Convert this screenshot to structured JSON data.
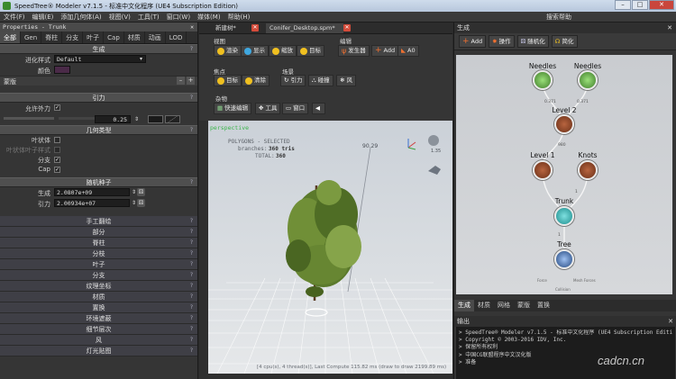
{
  "window": {
    "title": "SpeedTree® Modeler v7.1.5 - 标准中文化程序 (UE4 Subscription Edition)",
    "controls": [
      "–",
      "□",
      "✕"
    ]
  },
  "menu": {
    "items": [
      "文件(F)",
      "编辑(E)",
      "添加几何体(A)",
      "视图(V)",
      "工具(T)",
      "窗口(W)",
      "媒体(M)",
      "帮助(H)"
    ],
    "search_help": "搜索帮助"
  },
  "properties": {
    "panel_title": "Properties - Trunk",
    "tabs": [
      "全部",
      "Gen",
      "脊柱",
      "分支",
      "叶子",
      "Cap",
      "材质",
      "动画",
      "LOD"
    ],
    "sections": {
      "generation": "生成",
      "generation_style_label": "进化样式",
      "generation_style_value": "Default",
      "generation_color_label": "颜色",
      "mask": "蒙版",
      "mask_buttons": [
        "–",
        "+"
      ],
      "gravity": "引力",
      "gravity_allow_label": "允许外力",
      "gravity_value": "0.25",
      "geometry_type": "几何类型",
      "leaf_shape_label": "叶状体",
      "leaf_shape_sub_label": "叶状体叶子样式",
      "branches_label": "分支",
      "cap_label": "Cap",
      "random_seed": "随机种子",
      "seed_generation_label": "生成",
      "seed_generation_value": "2.0807e+09",
      "seed_gravity_label": "引力",
      "seed_gravity_value": "2.00934e+07"
    },
    "collapsed_sections": [
      "手工翻绘",
      "部分",
      "脊柱",
      "分枝",
      "叶子",
      "分支",
      "纹理坐标",
      "材质",
      "置换",
      "环境遮蔽",
      "细节层次",
      "风",
      "灯光贴图"
    ]
  },
  "documents": {
    "tabs": [
      "新建树*",
      "Conifer_Desktop.spm*"
    ]
  },
  "toolbar": {
    "view_group": "视图",
    "view_buttons": [
      "渲染",
      "显示",
      "缩放",
      "目标"
    ],
    "edit_group": "编辑",
    "edit_buttons": [
      "发生器",
      "Add",
      "A0"
    ],
    "focus_group": "焦点",
    "focus_buttons": [
      "目标",
      "清除"
    ],
    "scene_group": "场景",
    "scene_buttons": [
      "引力",
      "碰撞",
      "风"
    ],
    "misc_group": "杂物",
    "misc_buttons": [
      "快速编辑",
      "工具",
      "窗口"
    ]
  },
  "viewport": {
    "label": "perspective",
    "stats_title": "POLYGONS - SELECTED",
    "branches_label": "branches:",
    "branches_value": "360 tris",
    "total_label": "TOTAL:",
    "total_value": "360",
    "height_label": "90.29",
    "zoom_label": "1.35",
    "status": "[4 cpu(s), 4 thread(s)], Last Compute 115.82 ms (draw to draw 2199.89 ms)"
  },
  "generators": {
    "panel_title": "生成",
    "buttons": [
      "Add",
      "操作",
      "随机化",
      "简化"
    ],
    "nodes": {
      "needles_1": "Needles",
      "needles_2": "Needles",
      "level2": "Level 2",
      "level1": "Level 1",
      "knots": "Knots",
      "trunk": "Trunk",
      "tree": "Tree"
    },
    "edge_labels": {
      "n1": "0.371",
      "n2": "0.371",
      "l2": "980",
      "k": "1",
      "t": "1"
    },
    "footer_labels": [
      "Force",
      "Mesh Forces",
      "Collision"
    ]
  },
  "bottom_tabs": [
    "生成",
    "材质",
    "网格",
    "蒙版",
    "置换"
  ],
  "output": {
    "title": "输出",
    "lines": [
      "> SpeedTree® Modeler v7.1.5 - 标准中文化程序 (UE4 Subscription Edition)",
      "> Copyright © 2003-2016 IDV, Inc.",
      "> 保留所有权利",
      "> 中国CG联盟程序中文汉化版",
      "> 准备"
    ]
  },
  "watermark": "cadcn.cn",
  "colors": {
    "accent_red": "#d34b3a",
    "node_green": "#4f8d37",
    "node_brown": "#7a3f24",
    "node_cyan": "#2aa6a6",
    "node_blue": "#2b4e83"
  }
}
